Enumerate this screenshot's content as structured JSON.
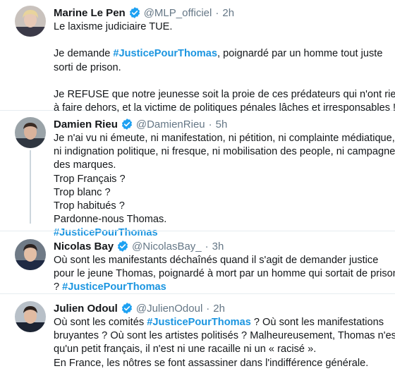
{
  "colors": {
    "link": "#1b95e0",
    "secondary": "#657786",
    "verified": "#1da1f2",
    "divider": "#e6ecf0"
  },
  "tweets": [
    {
      "name": "Marine Le Pen",
      "handle": "@MLP_officiel",
      "separator": "·",
      "time": "2h",
      "verified": true,
      "lines": [
        {
          "text": "Le laxisme judiciaire TUE."
        },
        {
          "gap": true
        },
        {
          "pre": "Je demande ",
          "tag": "#JusticePourThomas",
          "post": ", poignardé par un homme tout juste"
        },
        {
          "text": "sorti de prison."
        },
        {
          "gap": true
        },
        {
          "text": "Je REFUSE que notre jeunesse soit la proie de ces prédateurs qui n'ont rien"
        },
        {
          "text": "à faire dehors, et la victime de politiques pénales lâches et irresponsables !"
        }
      ]
    },
    {
      "name": "Damien Rieu",
      "handle": "@DamienRieu",
      "separator": "·",
      "time": "5h",
      "verified": true,
      "lines": [
        {
          "text": "Je n'ai vu ni émeute, ni manifestation, ni pétition, ni complainte médiatique,"
        },
        {
          "text": "ni indignation politique, ni fresque, ni mobilisation des people, ni campagne"
        },
        {
          "text": "des marques."
        },
        {
          "text": "Trop Français ?"
        },
        {
          "text": "Trop blanc ?"
        },
        {
          "text": "Trop habitués ?"
        },
        {
          "text": "Pardonne-nous Thomas."
        },
        {
          "pre": "",
          "tag": "#JusticePourThomas",
          "post": ""
        }
      ]
    },
    {
      "name": "Nicolas Bay",
      "handle": "@NicolasBay_",
      "separator": "·",
      "time": "3h",
      "verified": true,
      "lines": [
        {
          "text": "Où sont les manifestants déchaînés quand il s'agit de demander justice"
        },
        {
          "text": "pour le jeune Thomas, poignardé à mort par un homme qui sortait de prison"
        },
        {
          "pre": "? ",
          "tag": "#JusticePourThomas",
          "post": ""
        }
      ]
    },
    {
      "name": "Julien Odoul",
      "handle": "@JulienOdoul",
      "separator": "·",
      "time": "2h",
      "verified": true,
      "lines": [
        {
          "pre": "Où sont les comités ",
          "tag": "#JusticePourThomas",
          "post": " ? Où sont les manifestations"
        },
        {
          "text": "bruyantes ? Où sont les artistes politisés ? Malheureusement, Thomas n'est"
        },
        {
          "text": "qu'un petit français, il n'est ni une racaille ni un « racisé »."
        },
        {
          "text": "En France, les nôtres se font assassiner dans l'indifférence générale."
        }
      ]
    }
  ]
}
